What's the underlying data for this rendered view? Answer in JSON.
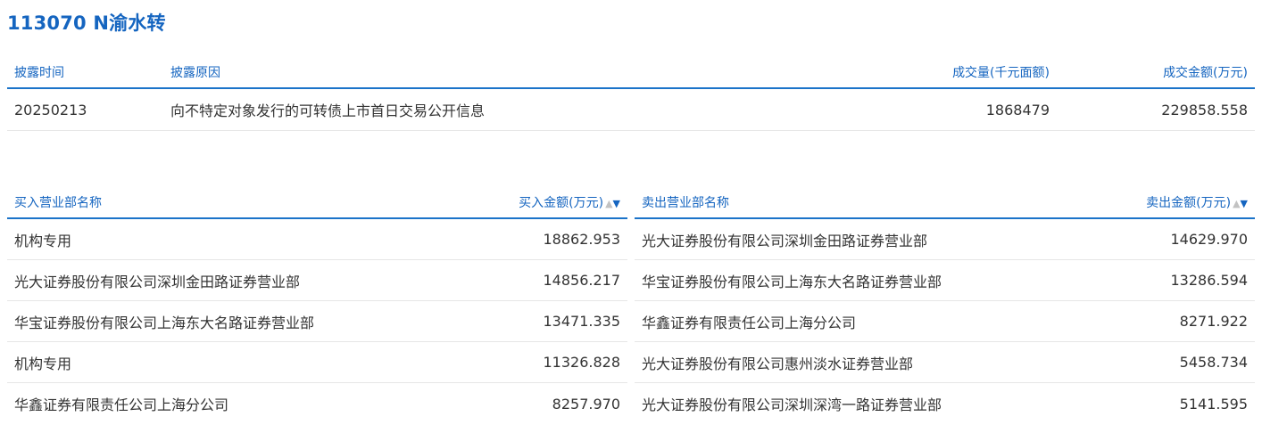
{
  "title": "113070 N渝水转",
  "disclosure": {
    "headers": {
      "date": "披露时间",
      "reason": "披露原因",
      "volume": "成交量(千元面额)",
      "amount": "成交金额(万元)"
    },
    "row": {
      "date": "20250213",
      "reason": "向不特定对象发行的可转债上市首日交易公开信息",
      "volume": "1868479",
      "amount": "229858.558"
    }
  },
  "buy": {
    "header_name": "买入营业部名称",
    "header_amount": "买入金额(万元)",
    "sort_up": "▲",
    "sort_down": "▼",
    "rows": [
      {
        "name": "机构专用",
        "amount": "18862.953"
      },
      {
        "name": "光大证券股份有限公司深圳金田路证券营业部",
        "amount": "14856.217"
      },
      {
        "name": "华宝证券股份有限公司上海东大名路证券营业部",
        "amount": "13471.335"
      },
      {
        "name": "机构专用",
        "amount": "11326.828"
      },
      {
        "name": "华鑫证券有限责任公司上海分公司",
        "amount": "8257.970"
      }
    ]
  },
  "sell": {
    "header_name": "卖出营业部名称",
    "header_amount": "卖出金额(万元)",
    "sort_up": "▲",
    "sort_down": "▼",
    "rows": [
      {
        "name": "光大证券股份有限公司深圳金田路证券营业部",
        "amount": "14629.970"
      },
      {
        "name": "华宝证券股份有限公司上海东大名路证券营业部",
        "amount": "13286.594"
      },
      {
        "name": "华鑫证券有限责任公司上海分公司",
        "amount": "8271.922"
      },
      {
        "name": "光大证券股份有限公司惠州淡水证券营业部",
        "amount": "5458.734"
      },
      {
        "name": "光大证券股份有限公司深圳深湾一路证券营业部",
        "amount": "5141.595"
      }
    ]
  },
  "colors": {
    "accent": "#1565c0",
    "header_border": "#1a73c9",
    "row_border": "#e6e6e6",
    "text": "#333333"
  }
}
